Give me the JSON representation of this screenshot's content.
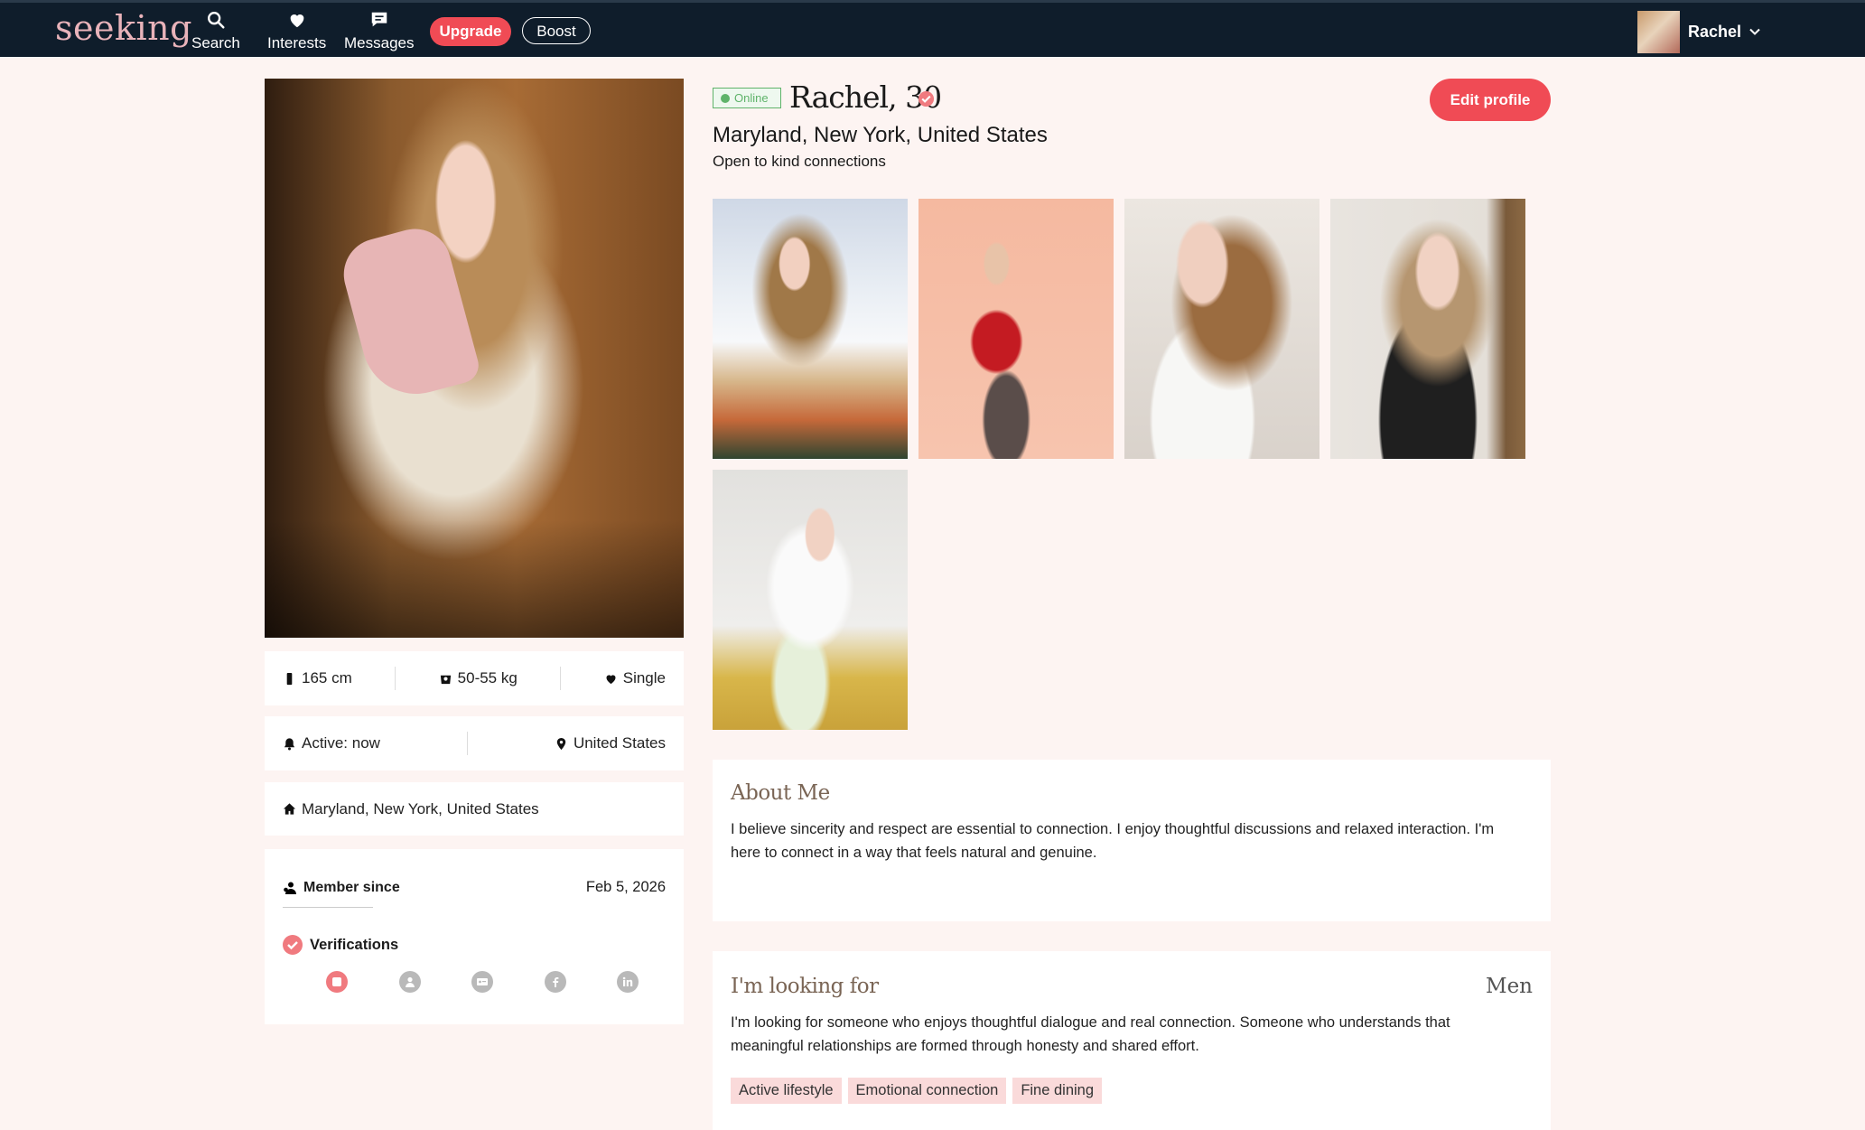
{
  "nav": {
    "logo": "seeking",
    "search_label": "Search",
    "interests_label": "Interests",
    "messages_label": "Messages",
    "upgrade_label": "Upgrade",
    "boost_label": "Boost",
    "user_name": "Rachel"
  },
  "profile": {
    "online_label": "Online",
    "name_age": "Rachel, 30",
    "location": "Maryland, New York, United States",
    "tagline": "Open to kind connections",
    "edit_label": "Edit profile"
  },
  "stats": {
    "height": "165 cm",
    "weight": "50-55 kg",
    "status": "Single",
    "active": "Active: now",
    "country": "United States",
    "home": "Maryland, New York, United States"
  },
  "membership": {
    "member_label": "Member since",
    "member_date": "Feb 5, 2026",
    "verifications_label": "Verifications",
    "verification_icons": [
      "photo-verified-icon",
      "person-icon",
      "id-card-icon",
      "facebook-icon",
      "linkedin-icon"
    ]
  },
  "about": {
    "title": "About Me",
    "text": "I believe sincerity and respect are essential to connection. I enjoy thoughtful discussions and relaxed interaction. I'm here to connect in a way that feels natural and genuine."
  },
  "looking": {
    "title": "I'm looking for",
    "gender": "Men",
    "text": "I'm looking for someone who enjoys thoughtful dialogue and real connection. Someone who understands that meaningful relationships are formed through honesty and shared effort.",
    "tags": [
      "Active lifestyle",
      "Emotional connection",
      "Fine dining"
    ]
  },
  "colors": {
    "nav_bg": "#0f1d2b",
    "accent": "#f04b55",
    "page_bg": "#fdf4f2",
    "online": "#5fb36a"
  }
}
